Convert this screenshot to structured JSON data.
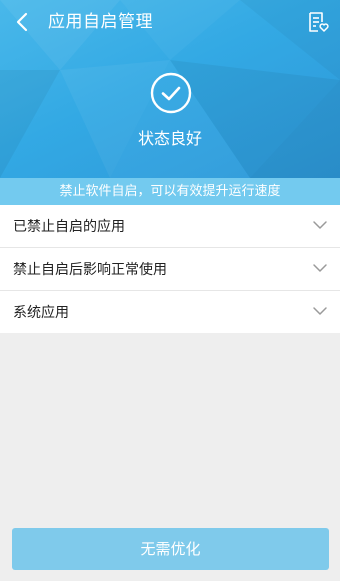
{
  "header": {
    "title": "应用自启管理",
    "back_icon": "back-chevron-icon",
    "action_icon": "document-heart-icon"
  },
  "status": {
    "icon": "check-circle-icon",
    "text": "状态良好"
  },
  "hint": {
    "text": "禁止软件自启，可以有效提升运行速度"
  },
  "sections": [
    {
      "label": "已禁止自启的应用",
      "icon": "chevron-down-icon"
    },
    {
      "label": "禁止自启后影响正常使用",
      "icon": "chevron-down-icon"
    },
    {
      "label": "系统应用",
      "icon": "chevron-down-icon"
    }
  ],
  "footer": {
    "button_label": "无需优化"
  },
  "colors": {
    "hero_gradient_start": "#49b8ea",
    "hero_gradient_end": "#2d97d8",
    "hint_bar": "#73caef",
    "button": "#7fcaeb",
    "background": "#eeeeee"
  }
}
